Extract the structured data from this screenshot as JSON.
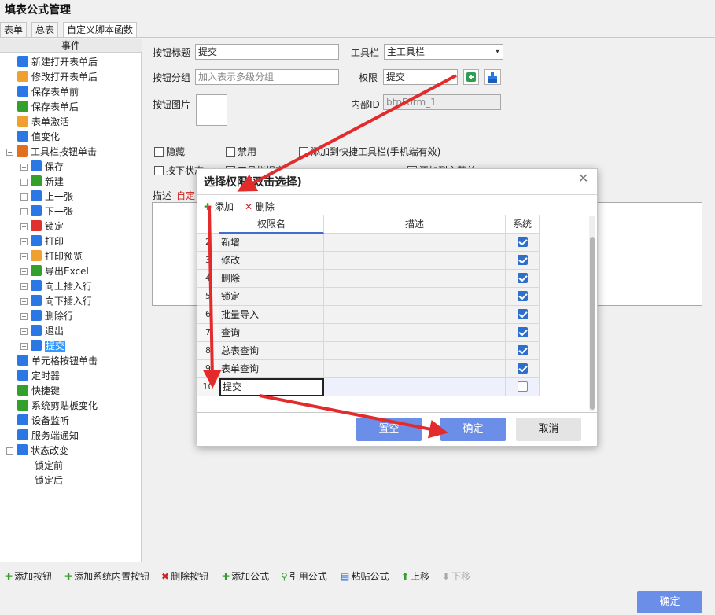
{
  "app_title": "填表公式管理",
  "tabs": [
    "表单",
    "总表",
    "自定义脚本函数"
  ],
  "left": {
    "header": "事件",
    "tree": [
      {
        "label": "新建打开表单后",
        "icon": "new-form-icon",
        "color": "#2b78e4",
        "level": 1
      },
      {
        "label": "修改打开表单后",
        "icon": "folder-open-icon",
        "color": "#f0a030",
        "level": 1
      },
      {
        "label": "保存表单前",
        "icon": "save-check-icon",
        "color": "#2b78e4",
        "level": 1
      },
      {
        "label": "保存表单后",
        "icon": "save-done-icon",
        "color": "#33a02c",
        "level": 1
      },
      {
        "label": "表单激活",
        "icon": "folder-open-icon",
        "color": "#f0a030",
        "level": 1
      },
      {
        "label": "值变化",
        "icon": "number-icon",
        "color": "#2b78e4",
        "level": 1
      },
      {
        "label": "工具栏按钮单击",
        "icon": "tools-icon",
        "color": "#e07020",
        "level": 1,
        "expanded": true
      },
      {
        "label": "保存",
        "icon": "save-icon",
        "color": "#2b78e4",
        "level": 2
      },
      {
        "label": "新建",
        "icon": "add-icon",
        "color": "#33a02c",
        "level": 2
      },
      {
        "label": "上一张",
        "icon": "prev-icon",
        "color": "#2b78e4",
        "level": 2
      },
      {
        "label": "下一张",
        "icon": "next-icon",
        "color": "#2b78e4",
        "level": 2
      },
      {
        "label": "锁定",
        "icon": "lock-icon",
        "color": "#e03030",
        "level": 2
      },
      {
        "label": "打印",
        "icon": "printer-icon",
        "color": "#2b78e4",
        "level": 2
      },
      {
        "label": "打印预览",
        "icon": "print-preview-icon",
        "color": "#f0a030",
        "level": 2
      },
      {
        "label": "导出Excel",
        "icon": "excel-icon",
        "color": "#33a02c",
        "level": 2
      },
      {
        "label": "向上插入行",
        "icon": "insert-row-above-icon",
        "color": "#2b78e4",
        "level": 2
      },
      {
        "label": "向下插入行",
        "icon": "insert-row-below-icon",
        "color": "#2b78e4",
        "level": 2
      },
      {
        "label": "删除行",
        "icon": "delete-row-icon",
        "color": "#2b78e4",
        "level": 2
      },
      {
        "label": "退出",
        "icon": "power-icon",
        "color": "#2b78e4",
        "level": 2
      },
      {
        "label": "提交",
        "icon": "submit-icon",
        "color": "#2b78e4",
        "level": 2,
        "selected": true
      },
      {
        "label": "单元格按钮单击",
        "icon": "dots-icon",
        "color": "#2b78e4",
        "level": 1
      },
      {
        "label": "定时器",
        "icon": "timer-icon",
        "color": "#2b78e4",
        "level": 1
      },
      {
        "label": "快捷键",
        "icon": "share-icon",
        "color": "#33a02c",
        "level": 1
      },
      {
        "label": "系统剪贴板变化",
        "icon": "scissors-icon",
        "color": "#33a02c",
        "level": 1
      },
      {
        "label": "设备监听",
        "icon": "device-icon",
        "color": "#2b78e4",
        "level": 1
      },
      {
        "label": "服务端通知",
        "icon": "notify-icon",
        "color": "#2b78e4",
        "level": 1
      },
      {
        "label": "状态改变",
        "icon": "status-icon",
        "color": "#2b78e4",
        "level": 1,
        "expanded": true
      },
      {
        "label": "锁定前",
        "icon": "",
        "color": "",
        "level": 2
      },
      {
        "label": "锁定后",
        "icon": "",
        "color": "",
        "level": 2
      }
    ]
  },
  "form": {
    "btn_title_label": "按钮标题",
    "btn_title_value": "提交",
    "toolbar_label": "工具栏",
    "toolbar_value": "主工具栏",
    "group_label": "按钮分组",
    "group_placeholder": "加入表示多级分组",
    "perm_label": "权限",
    "perm_value": "提交",
    "image_label": "按钮图片",
    "inner_id_label": "内部ID",
    "inner_id_value": "btnForm_1",
    "checkboxes": [
      "隐藏",
      "禁用",
      "添加到快捷工具栏(手机端有效)",
      "按下状态",
      "工具栏提交",
      "添加到主菜单"
    ],
    "desc_label": "描述",
    "desc_hint": "自定"
  },
  "bottom_toolbar": [
    {
      "label": "添加按钮",
      "icon": "plus-icon",
      "color": "#33a02c"
    },
    {
      "label": "添加系统内置按钮",
      "icon": "plus-icon",
      "color": "#33a02c"
    },
    {
      "label": "删除按钮",
      "icon": "x-icon",
      "color": "#d02020"
    },
    {
      "label": "添加公式",
      "icon": "plus-icon",
      "color": "#33a02c"
    },
    {
      "label": "引用公式",
      "icon": "link-icon",
      "color": "#33a02c"
    },
    {
      "label": "粘贴公式",
      "icon": "paste-icon",
      "color": "#2b78e4"
    },
    {
      "label": "上移",
      "icon": "up-arrow-icon",
      "color": "#33a02c"
    },
    {
      "label": "下移",
      "icon": "down-arrow-icon",
      "color": "#aaaaaa"
    }
  ],
  "ok_label": "确定",
  "dialog": {
    "title": "选择权限(双击选择)",
    "add_label": "添加",
    "delete_label": "删除",
    "columns": [
      "权限名",
      "描述",
      "系统"
    ],
    "rows": [
      {
        "num": "2",
        "name": "新增",
        "desc": "",
        "system": true
      },
      {
        "num": "3",
        "name": "修改",
        "desc": "",
        "system": true
      },
      {
        "num": "4",
        "name": "删除",
        "desc": "",
        "system": true
      },
      {
        "num": "5",
        "name": "锁定",
        "desc": "",
        "system": true
      },
      {
        "num": "6",
        "name": "批量导入",
        "desc": "",
        "system": true
      },
      {
        "num": "7",
        "name": "查询",
        "desc": "",
        "system": true
      },
      {
        "num": "8",
        "name": "总表查询",
        "desc": "",
        "system": true
      },
      {
        "num": "9",
        "name": "表单查询",
        "desc": "",
        "system": true
      },
      {
        "num": "10",
        "name": "提交",
        "desc": "",
        "system": false
      }
    ],
    "clear_label": "置空",
    "confirm_label": "确定",
    "cancel_label": "取消"
  },
  "colors": {
    "accent": "#6b8ee8",
    "arrow": "#e32b2b",
    "selection": "#3399ff"
  }
}
